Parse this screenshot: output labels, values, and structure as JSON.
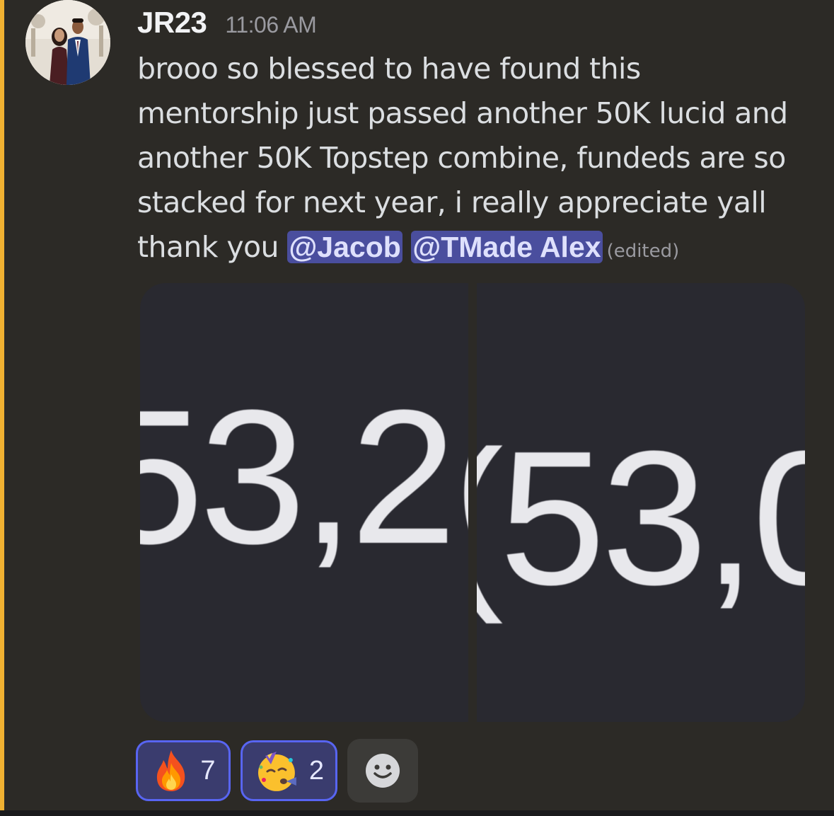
{
  "message": {
    "author": "JR23",
    "timestamp": "11:06 AM",
    "lines": [
      "brooo so blessed to have found this",
      "mentorship just passed another 50K lucid and",
      "another 50K Topstep combine, fundeds are so",
      "stacked for next year, i really appreciate yall"
    ],
    "last_line_text": "thank you",
    "mentions": [
      "@Jacob",
      "@TMade Alex"
    ],
    "edited_label": "(edited)"
  },
  "attachments": [
    {
      "visible_text": "53,2("
    },
    {
      "visible_text": "(53,0"
    }
  ],
  "reactions": [
    {
      "icon": "fire-emoji-icon",
      "count": "7"
    },
    {
      "icon": "partying-face-emoji-icon",
      "count": "2"
    }
  ],
  "colors": {
    "highlight_bar": "#f0b132",
    "mention_bg": "#4a4e9e",
    "reaction_border": "#5865f2"
  }
}
